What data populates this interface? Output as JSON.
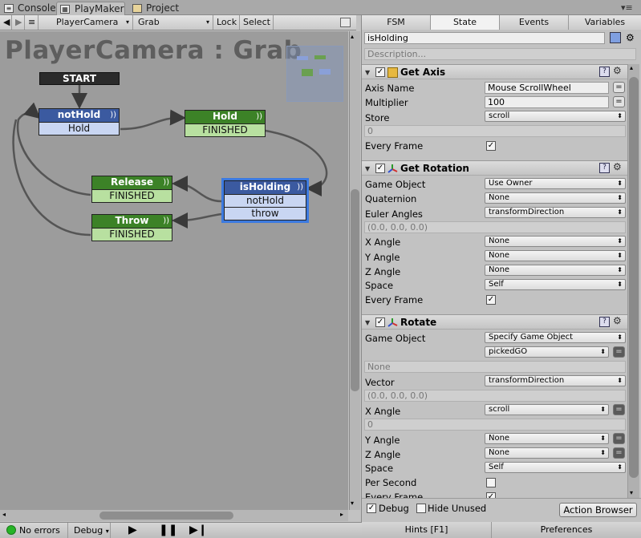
{
  "tabs": {
    "console": "Console",
    "playmaker": "PlayMaker",
    "project": "Project"
  },
  "toolbar": {
    "fsm": "PlayerCamera",
    "state": "Grab",
    "lock": "Lock",
    "select": "Select"
  },
  "graph": {
    "title": "PlayerCamera : Grab",
    "start": "START",
    "nodes": {
      "nothold": {
        "title": "notHold",
        "rows": [
          "Hold"
        ]
      },
      "hold": {
        "title": "Hold",
        "rows": [
          "FINISHED"
        ]
      },
      "release": {
        "title": "Release",
        "rows": [
          "FINISHED"
        ]
      },
      "throw": {
        "title": "Throw",
        "rows": [
          "FINISHED"
        ]
      },
      "isholding": {
        "title": "isHolding",
        "rows": [
          "notHold",
          "throw"
        ]
      }
    }
  },
  "status": {
    "errors": "No errors",
    "debug": "Debug"
  },
  "inspector": {
    "tabs": [
      "FSM",
      "State",
      "Events",
      "Variables"
    ],
    "state_name": "isHolding",
    "description_placeholder": "Description...",
    "colors": {
      "accent": "#7f9fe0",
      "selected_outline": "#3c7ae0"
    },
    "get_axis": {
      "title": "Get Axis",
      "axis_name_label": "Axis Name",
      "axis_name": "Mouse ScrollWheel",
      "multiplier_label": "Multiplier",
      "multiplier": "100",
      "store_label": "Store",
      "store": "scroll",
      "store_value": "0",
      "every_frame_label": "Every Frame"
    },
    "get_rotation": {
      "title": "Get Rotation",
      "game_object_label": "Game Object",
      "game_object": "Use Owner",
      "quaternion_label": "Quaternion",
      "quaternion": "None",
      "euler_label": "Euler Angles",
      "euler": "transformDirection",
      "euler_value": "(0.0, 0.0, 0.0)",
      "x_label": "X Angle",
      "x": "None",
      "y_label": "Y Angle",
      "y": "None",
      "z_label": "Z Angle",
      "z": "None",
      "space_label": "Space",
      "space": "Self",
      "every_frame_label": "Every Frame"
    },
    "rotate": {
      "title": "Rotate",
      "game_object_label": "Game Object",
      "game_object": "Specify Game Object",
      "game_object_var": "pickedGO",
      "none_value": "None",
      "vector_label": "Vector",
      "vector": "transformDirection",
      "vector_value": "(0.0, 0.0, 0.0)",
      "x_label": "X Angle",
      "x": "scroll",
      "x_value": "0",
      "y_label": "Y Angle",
      "y": "None",
      "z_label": "Z Angle",
      "z": "None",
      "space_label": "Space",
      "space": "Self",
      "per_second_label": "Per Second",
      "every_frame_label": "Every Frame"
    },
    "footer": {
      "debug": "Debug",
      "hide_unused": "Hide Unused",
      "action_browser": "Action Browser"
    },
    "bottom": {
      "hints": "Hints [F1]",
      "preferences": "Preferences"
    }
  }
}
